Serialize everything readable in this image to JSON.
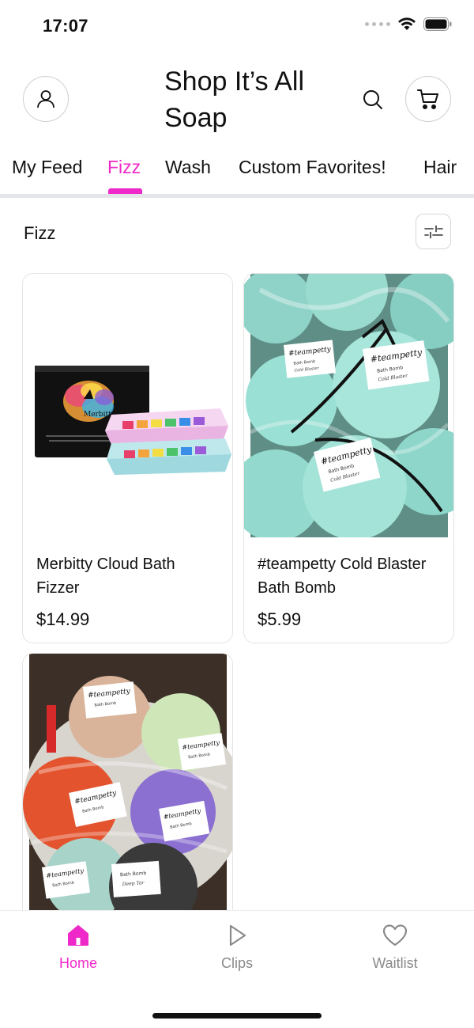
{
  "status_bar": {
    "time": "17:07"
  },
  "header": {
    "title": "Shop It’s All Soap"
  },
  "tabs": [
    {
      "label": "My Feed",
      "active": false
    },
    {
      "label": "Fizz",
      "active": true
    },
    {
      "label": "Wash",
      "active": false
    },
    {
      "label": "Custom Favorites!",
      "active": false
    },
    {
      "label": "Hair",
      "active": false
    }
  ],
  "section": {
    "title": "Fizz"
  },
  "products": [
    {
      "name": "Merbitty Cloud Bath Fizzer",
      "price": "$14.99",
      "image_text": "Merbitty"
    },
    {
      "name": "#teampetty Cold Blaster Bath Bomb",
      "price": "$5.99",
      "image_text": "#teampetty"
    },
    {
      "name": "",
      "price": "",
      "image_text": "#teampetty"
    }
  ],
  "bottom_nav": [
    {
      "label": "Home",
      "icon": "home-icon",
      "active": true
    },
    {
      "label": "Clips",
      "icon": "play-icon",
      "active": false
    },
    {
      "label": "Waitlist",
      "icon": "heart-icon",
      "active": false
    }
  ],
  "colors": {
    "accent": "#ef29c9",
    "border": "#e4e4e4",
    "muted": "#8a8a8a"
  }
}
